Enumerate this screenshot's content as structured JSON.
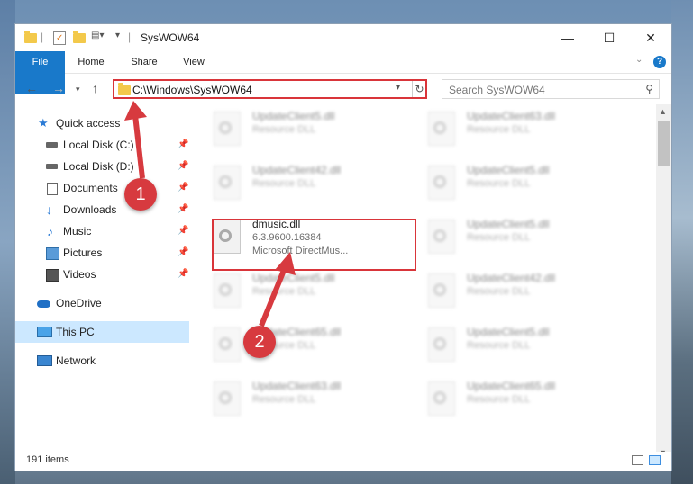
{
  "window": {
    "title": "SysWOW64",
    "controls": [
      "—",
      "☐",
      "✕"
    ]
  },
  "ribbon": {
    "tabs": [
      "File",
      "Home",
      "Share",
      "View"
    ],
    "help": "?"
  },
  "address": {
    "path": "C:\\Windows\\SysWOW64",
    "search_placeholder": "Search SysWOW64"
  },
  "sidebar": {
    "items": [
      {
        "label": "Quick access",
        "icon": "star-icon",
        "pinned": false
      },
      {
        "label": "Local Disk (C:)",
        "icon": "drive-icon",
        "pinned": true
      },
      {
        "label": "Local Disk (D:)",
        "icon": "drive-icon",
        "pinned": true
      },
      {
        "label": "Documents",
        "icon": "document-icon",
        "pinned": true
      },
      {
        "label": "Downloads",
        "icon": "download-icon",
        "pinned": true
      },
      {
        "label": "Music",
        "icon": "music-icon",
        "pinned": true
      },
      {
        "label": "Pictures",
        "icon": "pictures-icon",
        "pinned": true
      },
      {
        "label": "Videos",
        "icon": "video-icon",
        "pinned": true
      },
      {
        "label": "OneDrive",
        "icon": "cloud-icon",
        "pinned": false
      },
      {
        "label": "This PC",
        "icon": "computer-icon",
        "pinned": false
      },
      {
        "label": "Network",
        "icon": "network-icon",
        "pinned": false
      }
    ]
  },
  "files": {
    "col1": [
      {
        "name": "UpdateClient5.dll",
        "type": "Resource DLL"
      },
      {
        "name": "UpdateClient42.dll",
        "type": "Resource DLL"
      },
      {
        "name": "dmusic.dll",
        "version": "6.3.9600.16384",
        "desc": "Microsoft DirectMus..."
      },
      {
        "name": "UpdateClient5.dll",
        "type": "Resource DLL"
      },
      {
        "name": "UpdateClient65.dll",
        "type": "Resource DLL"
      },
      {
        "name": "UpdateClient63.dll",
        "type": "Resource DLL"
      }
    ],
    "col2": [
      {
        "name": "UpdateClient63.dll",
        "type": "Resource DLL"
      },
      {
        "name": "UpdateClient5.dll",
        "type": "Resource DLL"
      },
      {
        "name": "UpdateClient5.dll",
        "type": "Resource DLL"
      },
      {
        "name": "UpdateClient42.dll",
        "type": "Resource DLL"
      },
      {
        "name": "UpdateClient5.dll",
        "type": "Resource DLL"
      },
      {
        "name": "UpdateClient65.dll",
        "type": "Resource DLL"
      }
    ]
  },
  "status": {
    "item_count": "191 items"
  },
  "annotations": {
    "step1": "1",
    "step2": "2",
    "highlight_color": "#d9353a"
  }
}
